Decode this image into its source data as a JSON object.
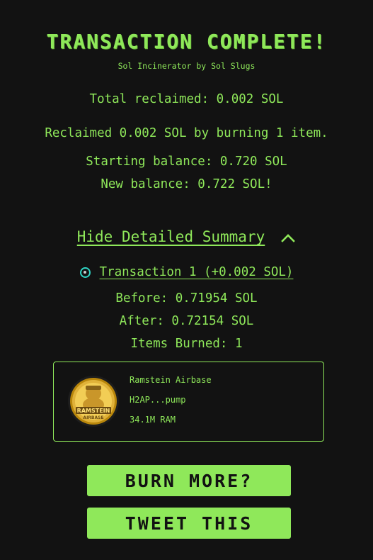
{
  "header": {
    "title": "TRANSACTION COMPLETE!",
    "subtitle": "Sol Incinerator by Sol Slugs"
  },
  "summary": {
    "total_reclaimed": "Total reclaimed: 0.002 SOL",
    "reclaimed_line": "Reclaimed 0.002 SOL by burning 1 item.",
    "starting_balance": "Starting balance: 0.720 SOL",
    "new_balance": "New balance: 0.722 SOL!"
  },
  "details": {
    "toggle_label": "Hide Detailed Summary",
    "transaction_label": "Transaction 1 (+0.002 SOL)",
    "before": "Before: 0.71954 SOL",
    "after": "After: 0.72154 SOL",
    "items_burned": "Items Burned: 1"
  },
  "token": {
    "name": "Ramstein Airbase",
    "address": "H2AP...pump",
    "amount": "34.1M RAM",
    "logo_text_line1": "RAMSTEIN",
    "logo_text_line2": "AIRBASE",
    "icon": "token-coin-icon"
  },
  "buttons": {
    "burn_more": "BURN MORE?",
    "tweet": "TWEET THIS"
  },
  "colors": {
    "background": "#121212",
    "accent": "#8fe85a",
    "radio": "#2fd6c6"
  }
}
